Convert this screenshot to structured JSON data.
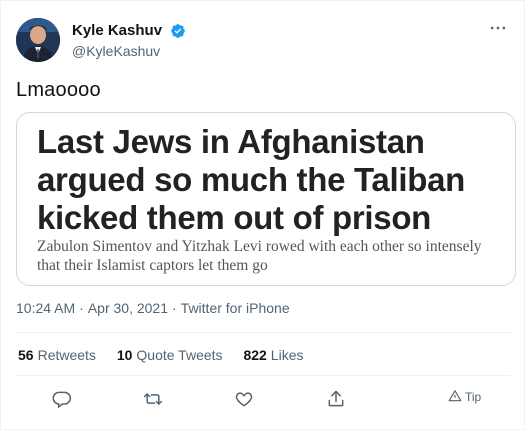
{
  "author": {
    "display_name": "Kyle Kashuv",
    "handle": "@KyleKashuv",
    "verified": true,
    "verified_color": "#1d9bf0"
  },
  "tweet": {
    "text": "Lmaoooo",
    "card": {
      "headline": "Last Jews in Afghanistan argued so much the Taliban kicked them out of prison",
      "subtitle": "Zabulon Simentov and Yitzhak Levi rowed with each other so intensely that their Islamist captors let them go"
    },
    "time": "10:24 AM",
    "date": "Apr 30, 2021",
    "source": "Twitter for iPhone"
  },
  "stats": {
    "retweets": {
      "count": "56",
      "label": "Retweets"
    },
    "quotes": {
      "count": "10",
      "label": "Quote Tweets"
    },
    "likes": {
      "count": "822",
      "label": "Likes"
    }
  },
  "actions": {
    "reply_icon": "reply-icon",
    "retweet_icon": "retweet-icon",
    "like_icon": "heart-icon",
    "share_icon": "share-icon",
    "tip_label": "Tip"
  },
  "colors": {
    "text_primary": "#0f1419",
    "text_secondary": "#536471",
    "border": "#cfd9de"
  }
}
